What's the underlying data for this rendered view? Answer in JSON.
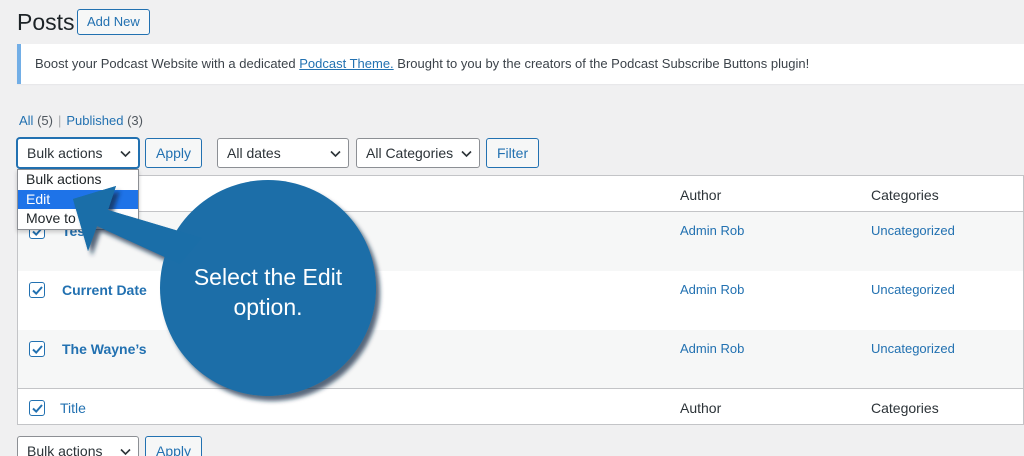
{
  "header": {
    "title": "Posts",
    "add_new_label": "Add New"
  },
  "notice": {
    "text_before": "Boost your Podcast Website with a dedicated ",
    "link_text": "Podcast Theme.",
    "text_after": " Brought to you by the creators of the Podcast Subscribe Buttons plugin!"
  },
  "views": {
    "all_label": "All",
    "all_count": "(5)",
    "separator": "|",
    "published_label": "Published",
    "published_count": "(3)"
  },
  "tablenav_top": {
    "bulk_actions_value": "Bulk actions",
    "apply_label": "Apply",
    "dates_value": "All dates",
    "categories_value": "All Categories",
    "filter_label": "Filter"
  },
  "bulk_dropdown": {
    "options": [
      "Bulk actions",
      "Edit",
      "Move to Trash"
    ],
    "selected_index": 1
  },
  "table": {
    "columns": {
      "author": "Author",
      "categories": "Categories"
    },
    "rows": [
      {
        "title": "Test",
        "author": "Admin Rob",
        "category": "Uncategorized",
        "checked": true
      },
      {
        "title": "Current Date",
        "author": "Admin Rob",
        "category": "Uncategorized",
        "checked": true
      },
      {
        "title": "The Wayne’s",
        "author": "Admin Rob",
        "category": "Uncategorized",
        "checked": true
      }
    ],
    "footer": {
      "title": "Title",
      "author": "Author",
      "categories": "Categories"
    }
  },
  "tablenav_bottom": {
    "bulk_actions_value": "Bulk actions",
    "apply_label": "Apply"
  },
  "callout": {
    "line1": "Select the Edit",
    "line2": "option.",
    "color": "#1a6ea8",
    "shadow_color": "#0d3a5c"
  },
  "colors": {
    "accent": "#2271b1",
    "notice_border": "#72aee6",
    "dropdown_selected": "#1e73e8"
  },
  "icons": {
    "select_chevron": "chevron-down-icon",
    "checkbox_check": "checkmark-icon"
  }
}
